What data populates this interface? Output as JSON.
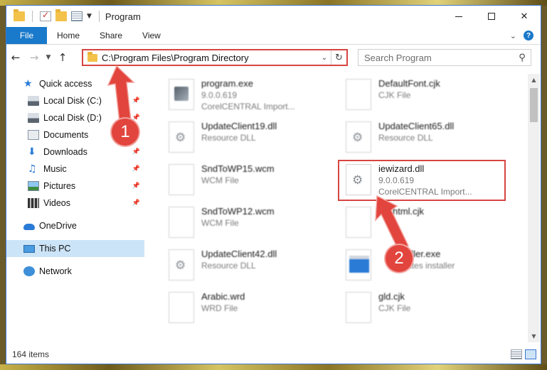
{
  "window": {
    "title": "Program"
  },
  "ribbon": {
    "tabs": [
      "File",
      "Home",
      "Share",
      "View"
    ]
  },
  "navigation": {
    "back": "←",
    "forward": "→",
    "up": "↑",
    "address": "C:\\Program Files\\Program Directory",
    "search_placeholder": "Search Program"
  },
  "sidebar": {
    "items": [
      {
        "label": "Quick access",
        "icon": "star-icon"
      },
      {
        "label": "Local Disk (C:)",
        "icon": "drive-icon",
        "pinned": true
      },
      {
        "label": "Local Disk (D:)",
        "icon": "drive-icon",
        "pinned": true
      },
      {
        "label": "Documents",
        "icon": "documents-icon",
        "pinned": true
      },
      {
        "label": "Downloads",
        "icon": "downloads-icon",
        "pinned": true
      },
      {
        "label": "Music",
        "icon": "music-icon",
        "pinned": true
      },
      {
        "label": "Pictures",
        "icon": "pictures-icon",
        "pinned": true
      },
      {
        "label": "Videos",
        "icon": "videos-icon",
        "pinned": true
      },
      {
        "label": "OneDrive",
        "icon": "onedrive-icon"
      },
      {
        "label": "This PC",
        "icon": "this-pc-icon",
        "selected": true
      },
      {
        "label": "Network",
        "icon": "network-icon"
      }
    ]
  },
  "files": [
    {
      "name": "program.exe",
      "line2": "9.0.0.619",
      "line3": "CorelCENTRAL Import...",
      "icon": "exe"
    },
    {
      "name": "DefaultFont.cjk",
      "line2": "CJK File",
      "line3": "",
      "icon": "blank"
    },
    {
      "name": "UpdateClient19.dll",
      "line2": "Resource DLL",
      "line3": "",
      "icon": "gear"
    },
    {
      "name": "UpdateClient65.dll",
      "line2": "Resource DLL",
      "line3": "",
      "icon": "gear"
    },
    {
      "name": "SndToWP15.wcm",
      "line2": "WCM File",
      "line3": "",
      "icon": "blank"
    },
    {
      "name": "iewizard.dll",
      "line2": "9.0.0.619",
      "line3": "CorelCENTRAL Import...",
      "icon": "gear"
    },
    {
      "name": "SndToWP12.wcm",
      "line2": "WCM File",
      "line3": "",
      "icon": "blank"
    },
    {
      "name": "html.cjk",
      "line2": "",
      "line3": "",
      "icon": "blank"
    },
    {
      "name": "UpdateClient42.dll",
      "line2": "Resource DLL",
      "line3": "",
      "icon": "gear"
    },
    {
      "name": "Installer.exe",
      "line2": "Updates installer",
      "line3": "",
      "icon": "inst"
    },
    {
      "name": "Arabic.wrd",
      "line2": "WRD File",
      "line3": "",
      "icon": "blank"
    },
    {
      "name": "gld.cjk",
      "line2": "CJK File",
      "line3": "",
      "icon": "blank"
    }
  ],
  "status": {
    "item_count": "164 items"
  },
  "annotations": {
    "step1": "1",
    "step2": "2"
  },
  "colors": {
    "accent": "#1979ca",
    "highlight": "#d64541",
    "badge": "#e2453d",
    "selected": "#cce4f7"
  }
}
